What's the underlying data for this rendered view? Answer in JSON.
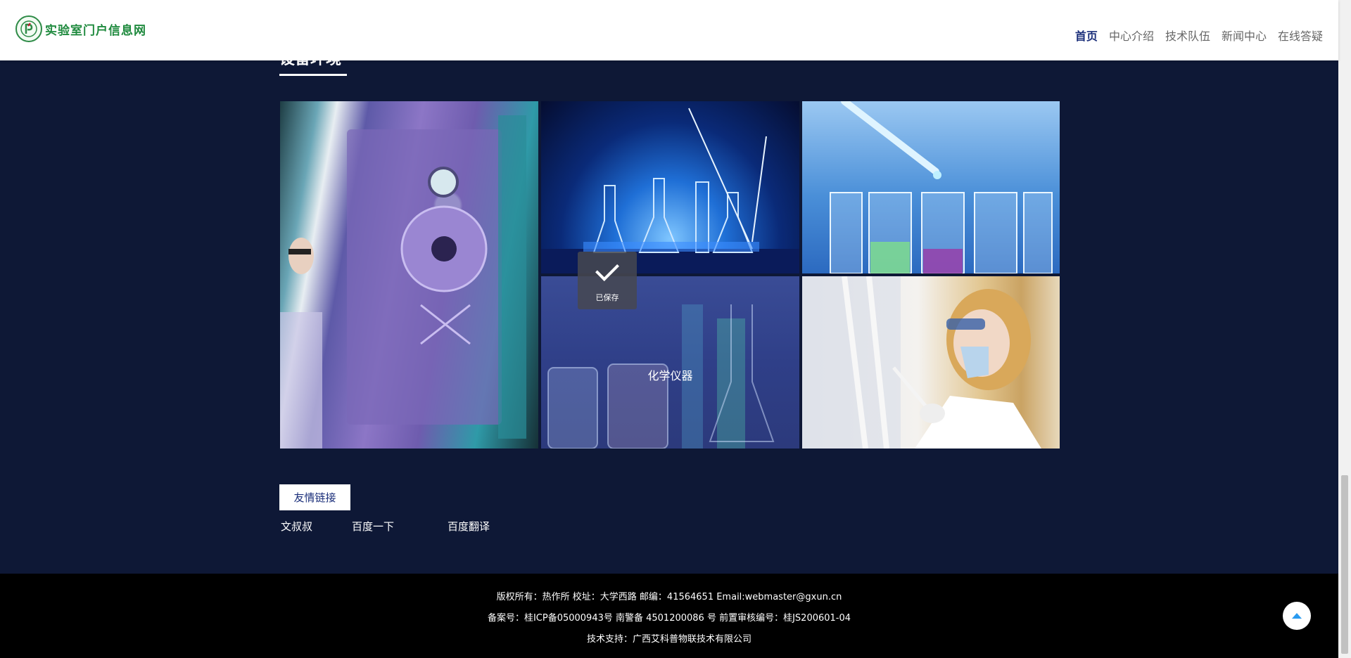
{
  "header": {
    "logo_text": "实验室门户信息网",
    "nav": [
      "首页",
      "中心介绍",
      "技术队伍",
      "新闻中心",
      "在线答疑"
    ]
  },
  "section": {
    "title": "设备环境"
  },
  "gallery": {
    "hover_label": "化学仪器"
  },
  "toast": {
    "label": "已保存"
  },
  "links": {
    "tab": "友情链接",
    "items": [
      "文叔叔",
      "百度一下",
      "百度翻译"
    ]
  },
  "footer": {
    "line1": "版权所有：热作所 校址：大学西路 邮编：41564651 Email:webmaster@gxun.cn",
    "line2": "备案号：桂ICP备05000943号 南警备 4501200086 号 前置审核编号：桂JS200601-04",
    "line3": "技术支持：广西艾科普物联技术有限公司"
  },
  "colors": {
    "background": "#0e1836",
    "nav_active": "#1a2e7a",
    "logo_green": "#1f8a3e",
    "footer_bg": "#000000",
    "to_top_arrow": "#2a9bf0"
  }
}
